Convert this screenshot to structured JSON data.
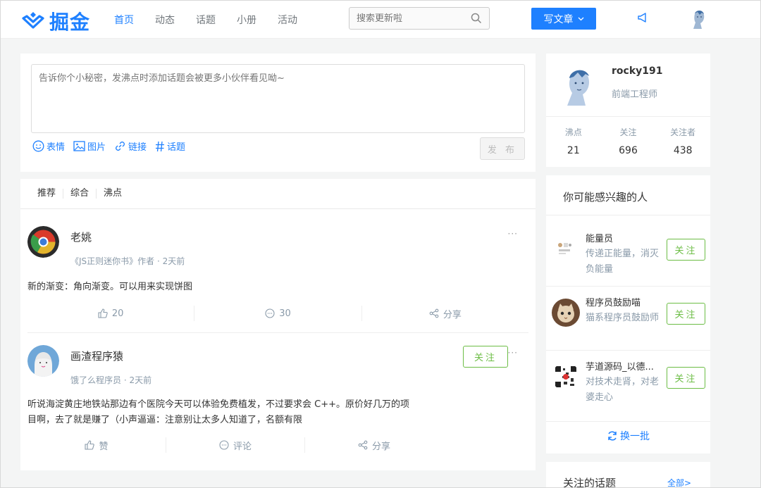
{
  "header": {
    "logo_text": "掘金",
    "nav": [
      "首页",
      "动态",
      "话题",
      "小册",
      "活动"
    ],
    "search_placeholder": "搜索更新啦",
    "write_label": "写文章"
  },
  "composer": {
    "placeholder": "告诉你个小秘密，发沸点时添加话题会被更多小伙伴看见呦~",
    "tools": [
      "表情",
      "图片",
      "链接",
      "话题"
    ],
    "publish_label": "发 布"
  },
  "feed": {
    "tabs": [
      "推荐",
      "综合",
      "沸点"
    ],
    "posts": [
      {
        "name": "老姚",
        "meta": "《JS正则迷你书》作者 · 2天前",
        "content": "新的渐变：角向渐变。可以用来实现饼图",
        "likes": "20",
        "comments": "30",
        "share": "分享"
      },
      {
        "name": "画渣程序猿",
        "meta": "饿了么程序员 · 2天前",
        "follow": "关注",
        "content_line1": "听说海淀黄庄地铁站那边有个医院今天可以体验免费植发，不过要求会 C++。原价好几万的项",
        "content_line2": "目啊，去了就是赚了（小声逼逼：注意别让太多人知道了，名额有限",
        "likes": "赞",
        "comments": "评论",
        "share": "分享"
      }
    ],
    "more": "···"
  },
  "profile": {
    "name": "rocky191",
    "title": "前端工程师",
    "stats": [
      {
        "label": "沸点",
        "value": "21"
      },
      {
        "label": "关注",
        "value": "696"
      },
      {
        "label": "关注者",
        "value": "438"
      }
    ]
  },
  "suggest": {
    "title": "你可能感兴趣的人",
    "people": [
      {
        "name": "能量员",
        "desc": "传递正能量，消灭负能量",
        "follow": "关注"
      },
      {
        "name": "程序员鼓励喵",
        "desc": "猫系程序员鼓励师",
        "follow": "关注"
      },
      {
        "name": "芋道源码_以德...",
        "desc": "对技术走肾，对老婆走心",
        "follow": "关注"
      }
    ],
    "refresh": "换一批"
  },
  "topics": {
    "title": "关注的话题",
    "all": "全部>"
  },
  "colors": {
    "accent": "#1e80ff",
    "follow_green": "#6cbd45"
  }
}
